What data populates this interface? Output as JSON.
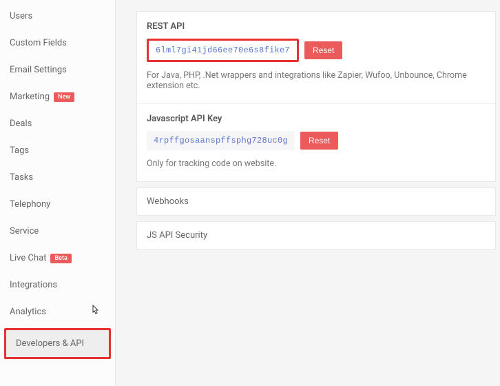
{
  "sidebar": {
    "items": [
      {
        "label": "Users"
      },
      {
        "label": "Custom Fields"
      },
      {
        "label": "Email Settings"
      },
      {
        "label": "Marketing",
        "badge": "New"
      },
      {
        "label": "Deals"
      },
      {
        "label": "Tags"
      },
      {
        "label": "Tasks"
      },
      {
        "label": "Telephony"
      },
      {
        "label": "Service"
      },
      {
        "label": "Live Chat",
        "badge": "Beta"
      },
      {
        "label": "Integrations"
      },
      {
        "label": "Analytics"
      },
      {
        "label": "Developers & API"
      }
    ]
  },
  "main": {
    "rest_api": {
      "title": "REST API",
      "key": "6lml7gi41jd66ee70e6s8fike7",
      "reset": "Reset",
      "help": "For Java, PHP, .Net wrappers and integrations like Zapier, Wufoo, Unbounce, Chrome extension etc."
    },
    "js_api": {
      "title": "Javascript API Key",
      "key": "4rpffgosaanspffsphg728uc0g",
      "reset": "Reset",
      "help": "Only for tracking code on website."
    },
    "accordion": {
      "webhooks": "Webhooks",
      "js_security": "JS API Security"
    }
  }
}
